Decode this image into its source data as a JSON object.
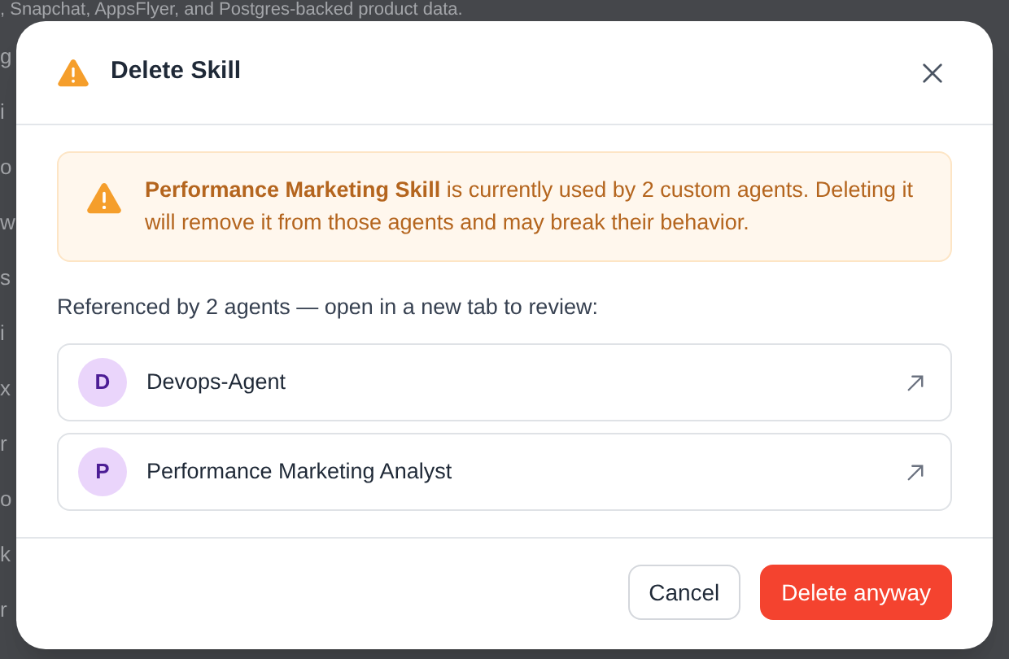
{
  "background": {
    "top_line": ", Snapchat, AppsFlyer, and Postgres-backed product data.",
    "fragments": [
      "g",
      "i",
      "o",
      "w",
      "s",
      "i",
      "x",
      "r",
      "o",
      "k",
      "r"
    ]
  },
  "dialog": {
    "title": "Delete Skill",
    "warning": "**Performance Marketing Skill** is currently used by 2 custom agents. Deleting it will remove it from those agents and may break their behavior.",
    "references_label": "Referenced by 2 agents — open in a new tab to review:",
    "agents": [
      {
        "initial": "D",
        "name": "Devops-Agent"
      },
      {
        "initial": "P",
        "name": "Performance Marketing Analyst"
      }
    ],
    "buttons": [
      {
        "label": "Cancel",
        "kind": "secondary"
      },
      {
        "label": "Delete anyway",
        "kind": "danger"
      }
    ]
  }
}
